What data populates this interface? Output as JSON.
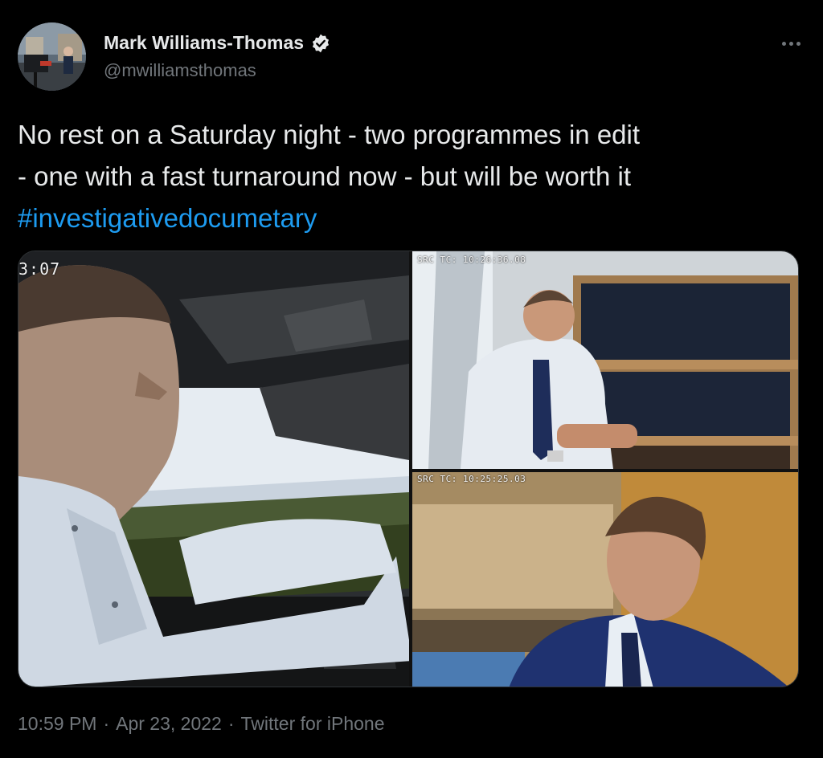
{
  "author": {
    "display_name": "Mark Williams-Thomas",
    "handle": "@mwilliamsthomas",
    "verified": true,
    "avatar_icon": "avatar-photo"
  },
  "tweet": {
    "text_lines": [
      "No rest on a Saturday night - two programmes in edit",
      "- one with a fast turnaround now - but will be worth it"
    ],
    "hashtag": "#investigativedocumetary"
  },
  "media": {
    "panels": [
      {
        "name": "car-interview-frame",
        "timecode": "3:07"
      },
      {
        "name": "library-interview-frame",
        "timecode": "SRC TC: 10:26:36.08"
      },
      {
        "name": "office-interview-frame",
        "timecode": "SRC TC: 10:25:25.03"
      }
    ]
  },
  "meta": {
    "time": "10:59 PM",
    "separator": "·",
    "date": "Apr 23, 2022",
    "source": "Twitter for iPhone"
  },
  "colors": {
    "background": "#000000",
    "text_primary": "#e7e9ea",
    "text_secondary": "#71767b",
    "link": "#1d9bf0",
    "verified_badge": "#e7e9ea"
  }
}
